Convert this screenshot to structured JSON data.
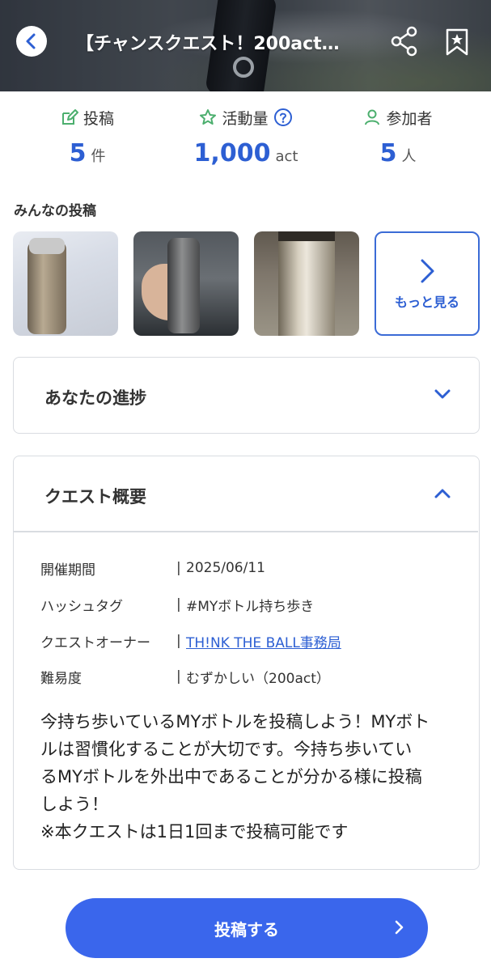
{
  "header": {
    "title": "【チャンスクエスト！200act…",
    "back_icon": "chevron-left-icon",
    "share_icon": "share-icon",
    "bookmark_icon": "bookmark-star-icon"
  },
  "stats": [
    {
      "label": "投稿",
      "value": "5",
      "unit": "件",
      "icon": "edit-icon"
    },
    {
      "label": "活動量",
      "value": "1,000",
      "unit": "act",
      "icon": "star-icon",
      "help_icon": "help-icon"
    },
    {
      "label": "参加者",
      "value": "5",
      "unit": "人",
      "icon": "person-icon"
    }
  ],
  "posts": {
    "title": "みんなの投稿",
    "more_label": "もっと見る"
  },
  "progress": {
    "title": "あなたの進捗"
  },
  "overview": {
    "title": "クエスト概要",
    "rows": [
      {
        "key": "開催期間",
        "sep": "|",
        "value": "2025/06/11"
      },
      {
        "key": "ハッシュタグ",
        "sep": "|",
        "value": "#MYボトル持ち歩き"
      },
      {
        "key": "クエストオーナー",
        "sep": "|",
        "value": "TH!NK THE BALL事務局"
      },
      {
        "key": "難易度",
        "sep": "|",
        "value": "むずかしい（200act）"
      }
    ],
    "description_lines": [
      "今持ち歩いているMYボトルを投稿しよう！MYボト",
      "ルは習慣化することが大切です。今持ち歩いてい",
      "るMYボトルを外出中であることが分かる様に投稿",
      "しよう！",
      "※本クエストは1日1回まで投稿可能です"
    ]
  },
  "post_button": {
    "label": "投稿する"
  },
  "colors": {
    "accent": "#2d5fd3",
    "button": "#3a66ec",
    "icon_green": "#4caf6e"
  }
}
